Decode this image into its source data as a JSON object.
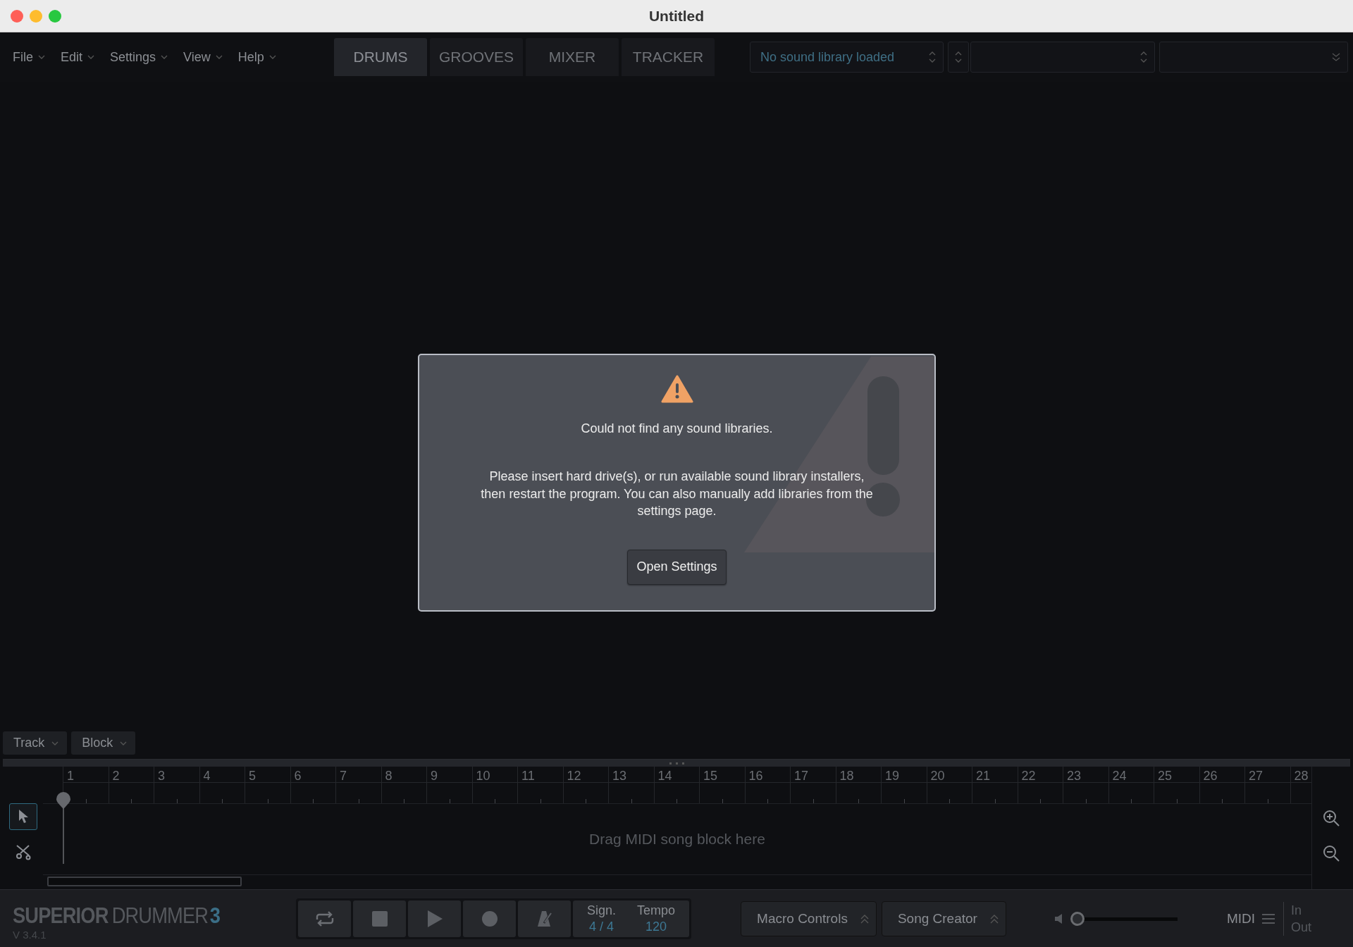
{
  "window": {
    "title": "Untitled"
  },
  "menu": [
    {
      "label": "File"
    },
    {
      "label": "Edit"
    },
    {
      "label": "Settings"
    },
    {
      "label": "View"
    },
    {
      "label": "Help"
    }
  ],
  "tabs": [
    {
      "label": "DRUMS",
      "selected": true
    },
    {
      "label": "GROOVES",
      "selected": false
    },
    {
      "label": "MIXER",
      "selected": false
    },
    {
      "label": "TRACKER",
      "selected": false
    }
  ],
  "library_selector": {
    "placeholder": "No sound library loaded"
  },
  "dialog": {
    "title": "Could not find any sound libraries.",
    "message": "Please insert hard drive(s), or run available sound library installers, then restart the program. You can also manually add libraries from the settings page.",
    "button": "Open Settings"
  },
  "song_menus": [
    {
      "label": "Track"
    },
    {
      "label": "Block"
    }
  ],
  "timeline": {
    "bars": [
      "1",
      "2",
      "3",
      "4",
      "5",
      "6",
      "7",
      "8",
      "9",
      "10",
      "11",
      "12",
      "13",
      "14",
      "15",
      "16",
      "17",
      "18",
      "19",
      "20",
      "21",
      "22",
      "23",
      "24",
      "25",
      "26",
      "27",
      "28"
    ],
    "tools": [
      {
        "kind": "pointer",
        "selected": true
      },
      {
        "kind": "cut",
        "selected": false
      }
    ],
    "placeholder": "Drag MIDI song block here"
  },
  "logo": {
    "word_1": "SUPERIOR",
    "word_2": "DRUMMER",
    "number": "3",
    "version": "V 3.4.1"
  },
  "transport": [
    {
      "kind": "loop"
    },
    {
      "kind": "stop"
    },
    {
      "kind": "play"
    },
    {
      "kind": "record"
    },
    {
      "kind": "metronome"
    }
  ],
  "signature": {
    "label": "Sign.",
    "value": "4 / 4"
  },
  "tempo": {
    "label": "Tempo",
    "value": "120"
  },
  "panels": [
    {
      "label": "Macro Controls"
    },
    {
      "label": "Song Creator"
    }
  ],
  "volume": {
    "level": 0.02
  },
  "midi": {
    "label": "MIDI",
    "in": "In",
    "out": "Out"
  }
}
